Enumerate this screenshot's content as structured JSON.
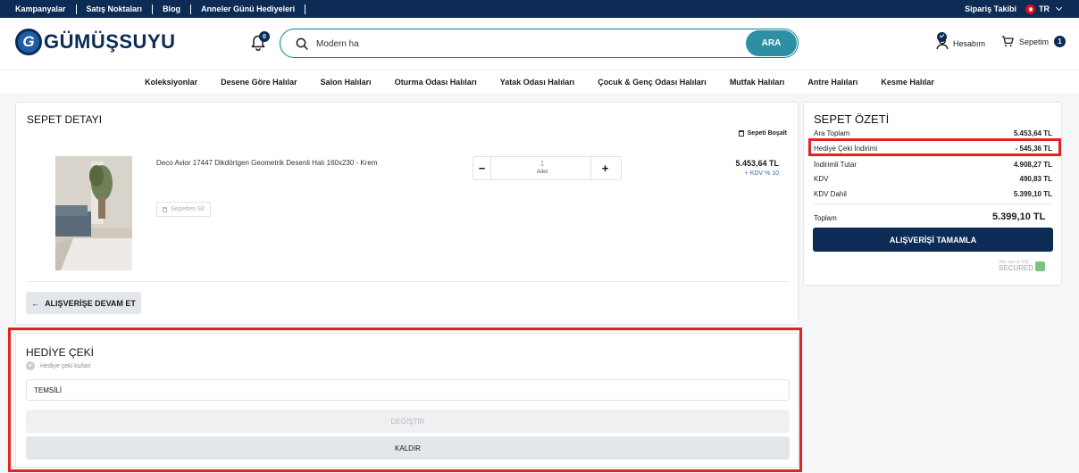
{
  "topbar": {
    "links": [
      "Kampanyalar",
      "Satış Noktaları",
      "Blog",
      "Anneler Günü Hediyeleri"
    ],
    "order_tracking": "Sipariş Takibi",
    "language": "TR"
  },
  "header": {
    "logo_letter": "G",
    "logo_text": "GÜMÜŞSUYU",
    "notification_count": "0",
    "search_value": "Modern ha",
    "search_button": "ARA",
    "account_label": "Hesabım",
    "cart_label": "Sepetim",
    "cart_count": "1"
  },
  "categories": [
    "Koleksiyonlar",
    "Desene Göre Halılar",
    "Salon Halıları",
    "Oturma Odası Halıları",
    "Yatak Odası Halıları",
    "Çocuk & Genç Odası Halıları",
    "Mutfak Halıları",
    "Antre Halıları",
    "Kesme Halılar"
  ],
  "cart": {
    "title": "SEPET DETAYI",
    "empty_cart": "Sepeti Boşalt",
    "item": {
      "name": "Deco Avior 17447 Dikdörtgen Geometrik Desenli Halı 160x230 - Krem",
      "remove_label": "Sepetten Sil",
      "quantity": "1",
      "unit": "Adet",
      "price": "5.453,64 TL",
      "vat_note": "+ KDV % 10"
    },
    "continue_button": "ALIŞVERİŞE DEVAM ET"
  },
  "summary": {
    "title": "SEPET ÖZETİ",
    "rows": [
      {
        "label": "Ara Toplam",
        "value": "5.453,64 TL"
      },
      {
        "label": "Hediye Çeki İndirimi",
        "value": "- 545,36 TL"
      },
      {
        "label": "İndirimli Tutar",
        "value": "4.908,27 TL"
      },
      {
        "label": "KDV",
        "value": "490,83 TL"
      },
      {
        "label": "KDV Dahil",
        "value": "5.399,10 TL"
      }
    ],
    "total_label": "Toplam",
    "total_value": "5.399,10 TL",
    "checkout_button": "ALIŞVERİŞİ TAMAMLA",
    "ssl_small": "Site size is SSL",
    "ssl_big": "SECURED"
  },
  "gift": {
    "title": "HEDİYE ÇEKİ",
    "checkbox_label": "Hediye çeki kullan",
    "code_value": "TEMSİLİ",
    "change_button": "DEĞİŞTİR",
    "remove_button": "KALDIR"
  },
  "colors": {
    "navy": "#0c2b55",
    "search_button": "#2d8fa3",
    "highlight": "#e02323"
  }
}
